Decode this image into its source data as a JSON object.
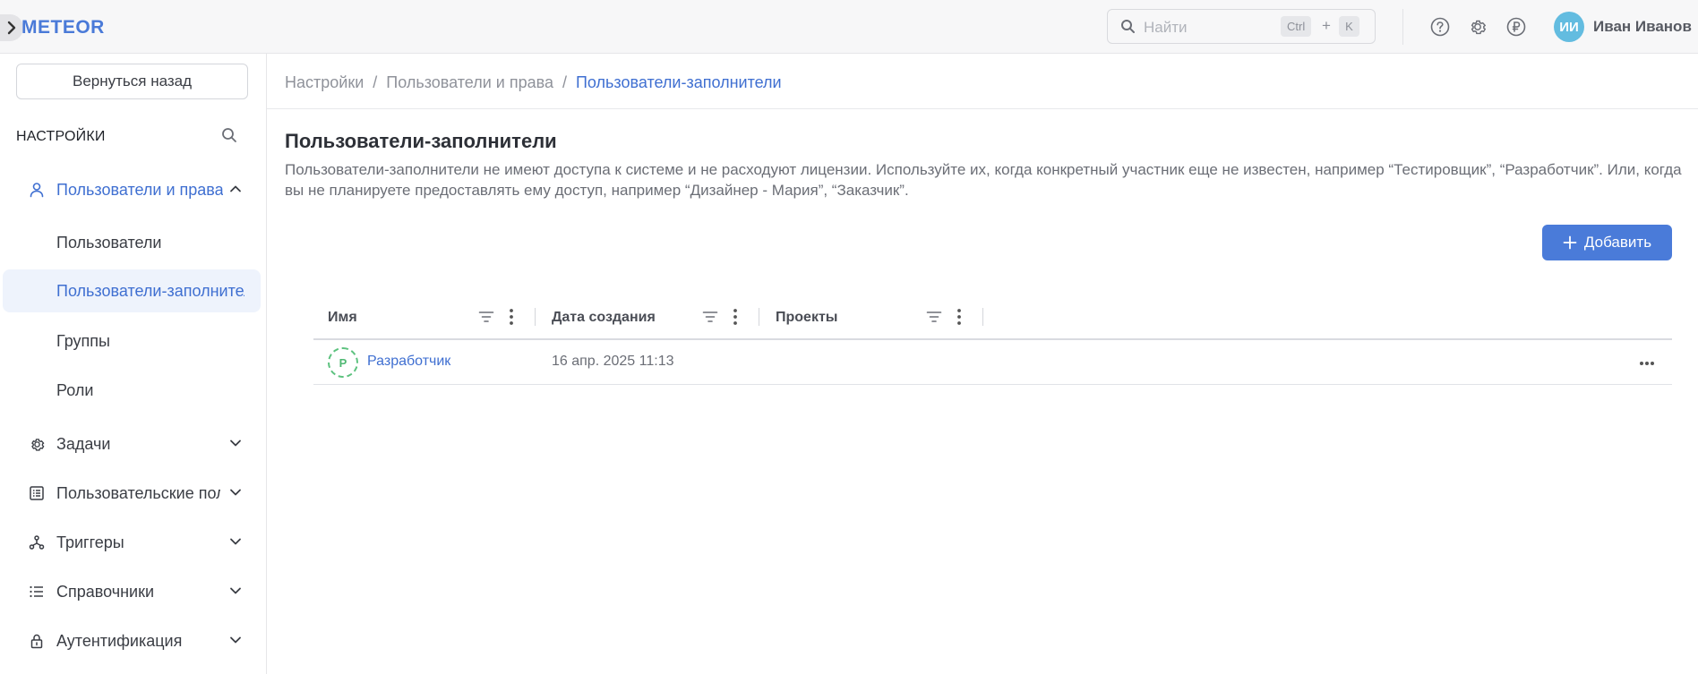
{
  "header": {
    "logo": "METEOR",
    "search_placeholder": "Найти",
    "shortcut_ctrl": "Ctrl",
    "shortcut_plus": "+",
    "shortcut_key": "K",
    "user_initials": "ИИ",
    "user_name": "Иван Иванов"
  },
  "sidebar": {
    "back_label": "Вернуться назад",
    "title": "НАСТРОЙКИ",
    "sections": [
      {
        "label": "Пользователи и права",
        "icon": "user-icon",
        "expanded": true
      },
      {
        "label": "Задачи",
        "icon": "gear-icon"
      },
      {
        "label": "Пользовательские поля",
        "icon": "form-icon"
      },
      {
        "label": "Триггеры",
        "icon": "nodes-icon"
      },
      {
        "label": "Справочники",
        "icon": "list-icon"
      },
      {
        "label": "Аутентификация",
        "icon": "lock-icon"
      }
    ],
    "subitems": [
      {
        "label": "Пользователи"
      },
      {
        "label": "Пользователи-заполнители",
        "active": true
      },
      {
        "label": "Группы"
      },
      {
        "label": "Роли"
      }
    ]
  },
  "breadcrumb": [
    "Настройки",
    "Пользователи и права",
    "Пользователи-заполнители"
  ],
  "page": {
    "title": "Пользователи-заполнители",
    "description": "Пользователи-заполнители не имеют доступа к системе и не расходуют лицензии. Используйте их, когда конкретный участник еще не известен, например “Тестировщик”, “Разработчик”. Или, когда вы не планируете предоставлять ему доступ, например “Дизайнер - Мария”, “Заказчик”.",
    "add_label": "Добавить"
  },
  "table": {
    "columns": [
      "Имя",
      "Дата создания",
      "Проекты"
    ],
    "rows": [
      {
        "initial": "Р",
        "name": "Разработчик",
        "created": "16 апр. 2025 11:13",
        "projects": ""
      }
    ]
  },
  "colors": {
    "accent": "#4a7bd9",
    "link": "#3f6fd1",
    "avatar_user": "#63bce0",
    "avatar_placeholder": "#5dc27f"
  }
}
